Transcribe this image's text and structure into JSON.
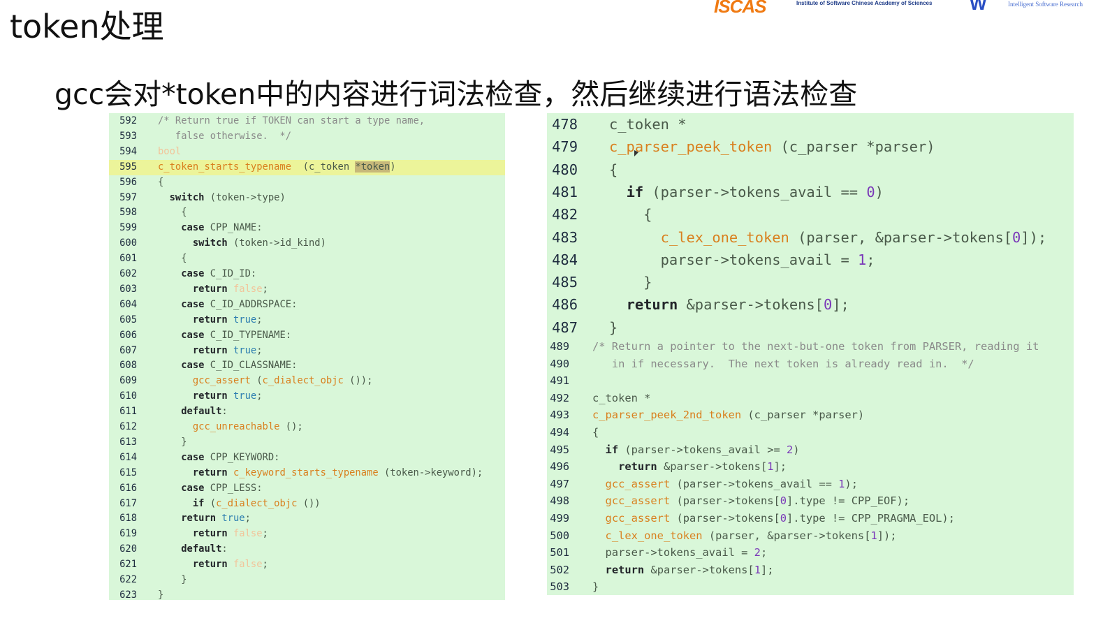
{
  "slide": {
    "title": "token处理",
    "subtitle": "gcc会对*token中的内容进行词法检查，然后继续进行语法检查",
    "logos": {
      "iscas": "ISCAS",
      "iscas_sub": "Institute of Software Chinese Academy of Sciences",
      "isr_mark": "W",
      "isr_sub": "Intelligent  Software  Research"
    }
  },
  "colors": {
    "panel_bg": "#d9f7d9",
    "highlight_line": "#ecf49a",
    "keyword": "#23262a",
    "function": "#d9801f",
    "comment": "#8a8a8a",
    "number": "#7a38b8"
  },
  "left_code": {
    "lines": [
      {
        "n": "592",
        "seg": [
          [
            "cm",
            "/* Return true if TOKEN can start a type name,"
          ]
        ]
      },
      {
        "n": "593",
        "seg": [
          [
            "cm",
            "   false otherwise.  */"
          ]
        ]
      },
      {
        "n": "594",
        "seg": [
          [
            "dim",
            "bool"
          ]
        ]
      },
      {
        "n": "595",
        "hl": true,
        "seg": [
          [
            "fn",
            "c_token_starts_typename"
          ],
          [
            "",
            "  (c_token "
          ],
          [
            "hlbox",
            "*token"
          ],
          [
            "",
            ")"
          ]
        ]
      },
      {
        "n": "596",
        "seg": [
          [
            "",
            "{"
          ]
        ]
      },
      {
        "n": "597",
        "seg": [
          [
            "",
            "  "
          ],
          [
            "kw",
            "switch"
          ],
          [
            "",
            " (token->type)"
          ]
        ]
      },
      {
        "n": "598",
        "seg": [
          [
            "",
            "    {"
          ]
        ]
      },
      {
        "n": "599",
        "seg": [
          [
            "",
            "    "
          ],
          [
            "kw",
            "case"
          ],
          [
            "",
            " CPP_NAME:"
          ]
        ]
      },
      {
        "n": "600",
        "seg": [
          [
            "",
            "      "
          ],
          [
            "kw",
            "switch"
          ],
          [
            "",
            " (token->id_kind)"
          ]
        ]
      },
      {
        "n": "601",
        "seg": [
          [
            "",
            "    {"
          ]
        ]
      },
      {
        "n": "602",
        "seg": [
          [
            "",
            "    "
          ],
          [
            "kw",
            "case"
          ],
          [
            "",
            " C_ID_ID:"
          ]
        ]
      },
      {
        "n": "603",
        "seg": [
          [
            "",
            "      "
          ],
          [
            "kw",
            "return"
          ],
          [
            "",
            " "
          ],
          [
            "dim",
            "false"
          ],
          [
            "",
            ";"
          ]
        ]
      },
      {
        "n": "604",
        "seg": [
          [
            "",
            "    "
          ],
          [
            "kw",
            "case"
          ],
          [
            "",
            " C_ID_ADDRSPACE:"
          ]
        ]
      },
      {
        "n": "605",
        "seg": [
          [
            "",
            "      "
          ],
          [
            "kw",
            "return"
          ],
          [
            "",
            " "
          ],
          [
            "bool",
            "true"
          ],
          [
            "",
            ";"
          ]
        ]
      },
      {
        "n": "606",
        "seg": [
          [
            "",
            "    "
          ],
          [
            "kw",
            "case"
          ],
          [
            "",
            " C_ID_TYPENAME:"
          ]
        ]
      },
      {
        "n": "607",
        "seg": [
          [
            "",
            "      "
          ],
          [
            "kw",
            "return"
          ],
          [
            "",
            " "
          ],
          [
            "bool",
            "true"
          ],
          [
            "",
            ";"
          ]
        ]
      },
      {
        "n": "608",
        "seg": [
          [
            "",
            "    "
          ],
          [
            "kw",
            "case"
          ],
          [
            "",
            " C_ID_CLASSNAME:"
          ]
        ]
      },
      {
        "n": "609",
        "seg": [
          [
            "",
            "      "
          ],
          [
            "fn",
            "gcc_assert"
          ],
          [
            "",
            " ("
          ],
          [
            "fn",
            "c_dialect_objc"
          ],
          [
            "",
            " ());"
          ]
        ]
      },
      {
        "n": "610",
        "seg": [
          [
            "",
            "      "
          ],
          [
            "kw",
            "return"
          ],
          [
            "",
            " "
          ],
          [
            "bool",
            "true"
          ],
          [
            "",
            ";"
          ]
        ]
      },
      {
        "n": "611",
        "seg": [
          [
            "",
            "    "
          ],
          [
            "kw",
            "default"
          ],
          [
            "",
            ":"
          ]
        ]
      },
      {
        "n": "612",
        "seg": [
          [
            "",
            "      "
          ],
          [
            "fn",
            "gcc_unreachable"
          ],
          [
            "",
            " ();"
          ]
        ]
      },
      {
        "n": "613",
        "seg": [
          [
            "",
            "    }"
          ]
        ]
      },
      {
        "n": "614",
        "seg": [
          [
            "",
            "    "
          ],
          [
            "kw",
            "case"
          ],
          [
            "",
            " CPP_KEYWORD:"
          ]
        ]
      },
      {
        "n": "615",
        "seg": [
          [
            "",
            "      "
          ],
          [
            "kw",
            "return"
          ],
          [
            "",
            " "
          ],
          [
            "fn",
            "c_keyword_starts_typename"
          ],
          [
            "",
            " (token->keyword);"
          ]
        ]
      },
      {
        "n": "616",
        "seg": [
          [
            "",
            "    "
          ],
          [
            "kw",
            "case"
          ],
          [
            "",
            " CPP_LESS:"
          ]
        ]
      },
      {
        "n": "617",
        "seg": [
          [
            "",
            "      "
          ],
          [
            "kw",
            "if"
          ],
          [
            "",
            " ("
          ],
          [
            "fn",
            "c_dialect_objc"
          ],
          [
            "",
            " ())"
          ]
        ]
      },
      {
        "n": "618",
        "seg": [
          [
            "",
            "    "
          ],
          [
            "kw",
            "return"
          ],
          [
            "",
            " "
          ],
          [
            "bool",
            "true"
          ],
          [
            "",
            ";"
          ]
        ]
      },
      {
        "n": "619",
        "seg": [
          [
            "",
            "      "
          ],
          [
            "kw",
            "return"
          ],
          [
            "",
            " "
          ],
          [
            "dim",
            "false"
          ],
          [
            "",
            ";"
          ]
        ]
      },
      {
        "n": "620",
        "seg": [
          [
            "",
            "    "
          ],
          [
            "kw",
            "default"
          ],
          [
            "",
            ":"
          ]
        ]
      },
      {
        "n": "621",
        "seg": [
          [
            "",
            "      "
          ],
          [
            "kw",
            "return"
          ],
          [
            "",
            " "
          ],
          [
            "dim",
            "false"
          ],
          [
            "",
            ";"
          ]
        ]
      },
      {
        "n": "622",
        "seg": [
          [
            "",
            "    }"
          ]
        ]
      },
      {
        "n": "623",
        "seg": [
          [
            "",
            "}"
          ]
        ]
      }
    ]
  },
  "right_code_large": {
    "lines": [
      {
        "n": "478",
        "seg": [
          [
            "",
            "c_token *"
          ]
        ]
      },
      {
        "n": "479",
        "seg": [
          [
            "fn",
            "c_parser_peek_token"
          ],
          [
            "",
            " (c_parser *parser)"
          ]
        ]
      },
      {
        "n": "480",
        "seg": [
          [
            "",
            "{"
          ]
        ]
      },
      {
        "n": "481",
        "seg": [
          [
            "",
            "  "
          ],
          [
            "kw",
            "if"
          ],
          [
            "",
            " (parser->tokens_avail == "
          ],
          [
            "num",
            "0"
          ],
          [
            "",
            ")"
          ]
        ]
      },
      {
        "n": "482",
        "seg": [
          [
            "",
            "    {"
          ]
        ]
      },
      {
        "n": "483",
        "seg": [
          [
            "",
            "      "
          ],
          [
            "fn",
            "c_lex_one_token"
          ],
          [
            "",
            " (parser, &parser->tokens["
          ],
          [
            "num",
            "0"
          ],
          [
            "",
            "]);"
          ]
        ]
      },
      {
        "n": "484",
        "seg": [
          [
            "",
            "      parser->tokens_avail = "
          ],
          [
            "num",
            "1"
          ],
          [
            "",
            ";"
          ]
        ]
      },
      {
        "n": "485",
        "seg": [
          [
            "",
            "    }"
          ]
        ]
      },
      {
        "n": "486",
        "seg": [
          [
            "",
            "  "
          ],
          [
            "kw",
            "return"
          ],
          [
            "",
            " &parser->tokens["
          ],
          [
            "num",
            "0"
          ],
          [
            "",
            "];"
          ]
        ]
      },
      {
        "n": "487",
        "seg": [
          [
            "",
            "}"
          ]
        ]
      }
    ]
  },
  "right_code_small": {
    "lines": [
      {
        "n": "489",
        "seg": [
          [
            "cm",
            "/* Return a pointer to the next-but-one token from PARSER, reading it"
          ]
        ]
      },
      {
        "n": "490",
        "seg": [
          [
            "cm",
            "   in if necessary.  The next token is already read in.  */"
          ]
        ]
      },
      {
        "n": "491",
        "seg": [
          [
            "",
            ""
          ]
        ]
      },
      {
        "n": "492",
        "seg": [
          [
            "",
            "c_token *"
          ]
        ]
      },
      {
        "n": "493",
        "seg": [
          [
            "fn",
            "c_parser_peek_2nd_token"
          ],
          [
            "",
            " (c_parser *parser)"
          ]
        ]
      },
      {
        "n": "494",
        "seg": [
          [
            "",
            "{"
          ]
        ]
      },
      {
        "n": "495",
        "seg": [
          [
            "",
            "  "
          ],
          [
            "kw",
            "if"
          ],
          [
            "",
            " (parser->tokens_avail >= "
          ],
          [
            "num",
            "2"
          ],
          [
            "",
            ")"
          ]
        ]
      },
      {
        "n": "496",
        "seg": [
          [
            "",
            "    "
          ],
          [
            "kw",
            "return"
          ],
          [
            "",
            " &parser->tokens["
          ],
          [
            "num",
            "1"
          ],
          [
            "",
            "];"
          ]
        ]
      },
      {
        "n": "497",
        "seg": [
          [
            "",
            "  "
          ],
          [
            "fn",
            "gcc_assert"
          ],
          [
            "",
            " (parser->tokens_avail == "
          ],
          [
            "num",
            "1"
          ],
          [
            "",
            "); "
          ]
        ]
      },
      {
        "n": "498",
        "seg": [
          [
            "",
            "  "
          ],
          [
            "fn",
            "gcc_assert"
          ],
          [
            "",
            " (parser->tokens["
          ],
          [
            "num",
            "0"
          ],
          [
            "",
            "].type != CPP_EOF);"
          ]
        ]
      },
      {
        "n": "499",
        "seg": [
          [
            "",
            "  "
          ],
          [
            "fn",
            "gcc_assert"
          ],
          [
            "",
            " (parser->tokens["
          ],
          [
            "num",
            "0"
          ],
          [
            "",
            "].type != CPP_PRAGMA_EOL);"
          ]
        ]
      },
      {
        "n": "500",
        "seg": [
          [
            "",
            "  "
          ],
          [
            "fn",
            "c_lex_one_token"
          ],
          [
            "",
            " (parser, &parser->tokens["
          ],
          [
            "num",
            "1"
          ],
          [
            "",
            "]);"
          ]
        ]
      },
      {
        "n": "501",
        "seg": [
          [
            "",
            "  parser->tokens_avail = "
          ],
          [
            "num",
            "2"
          ],
          [
            "",
            ";"
          ]
        ]
      },
      {
        "n": "502",
        "seg": [
          [
            "",
            "  "
          ],
          [
            "kw",
            "return"
          ],
          [
            "",
            " &parser->tokens["
          ],
          [
            "num",
            "1"
          ],
          [
            "",
            "];"
          ]
        ]
      },
      {
        "n": "503",
        "seg": [
          [
            "",
            "}"
          ]
        ]
      }
    ]
  }
}
